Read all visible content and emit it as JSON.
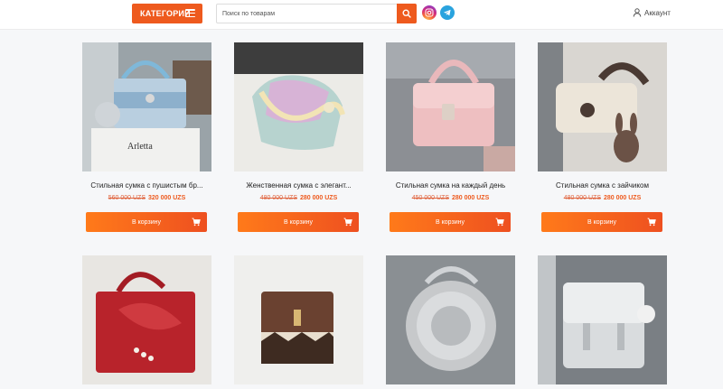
{
  "header": {
    "categories_label": "КАТЕГОРИИ",
    "search_placeholder": "Поиск по товарам",
    "account_label": "Аккаунт"
  },
  "colors": {
    "accent": "#ee5a1e",
    "price": "#ee5a1e",
    "old_price": "#e0633d"
  },
  "icons": [
    "menu-icon",
    "search-icon",
    "instagram-icon",
    "telegram-icon",
    "user-icon",
    "cart-icon"
  ],
  "products": [
    {
      "title": "Стильная сумка с пушистым бр...",
      "old_price": "560 000 UZS",
      "price": "320 000 UZS",
      "button": "В корзину"
    },
    {
      "title": "Женственная сумка с элегант...",
      "old_price": "480 000 UZS",
      "price": "280 000 UZS",
      "button": "В корзину"
    },
    {
      "title": "Стильная сумка на каждый день",
      "old_price": "450 000 UZS",
      "price": "280 000 UZS",
      "button": "В корзину"
    },
    {
      "title": "Стильная сумка с зайчиком",
      "old_price": "480 000 UZS",
      "price": "280 000 UZS",
      "button": "В корзину"
    },
    {
      "title": "",
      "old_price": "",
      "price": "",
      "button": ""
    },
    {
      "title": "",
      "old_price": "",
      "price": "",
      "button": ""
    },
    {
      "title": "",
      "old_price": "",
      "price": "",
      "button": ""
    },
    {
      "title": "",
      "old_price": "",
      "price": "",
      "button": ""
    }
  ]
}
